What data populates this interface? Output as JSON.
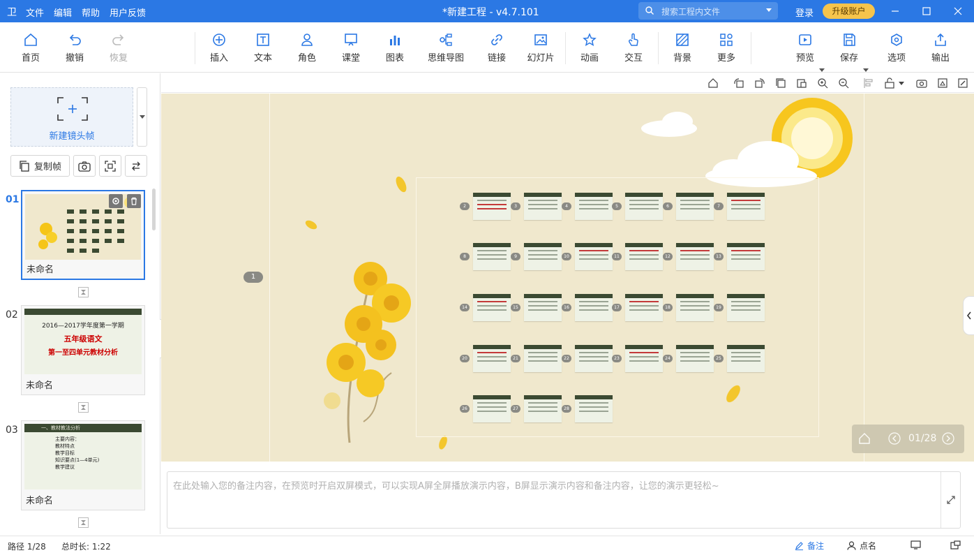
{
  "app": {
    "logo": "卫",
    "title": "*新建工程 - v4.7.101",
    "menu": [
      "文件",
      "编辑",
      "帮助",
      "用户反馈"
    ],
    "search_placeholder": "搜索工程内文件",
    "login": "登录",
    "upgrade": "升级账户"
  },
  "toolbar": {
    "home": "首页",
    "undo": "撤销",
    "redo": "恢复",
    "insert": "插入",
    "text": "文本",
    "role": "角色",
    "classroom": "课堂",
    "chart": "图表",
    "mindmap": "思维导图",
    "link": "链接",
    "slideshow": "幻灯片",
    "animation": "动画",
    "interaction": "交互",
    "background": "背景",
    "more": "更多",
    "preview": "预览",
    "save": "保存",
    "options": "选项",
    "export": "输出"
  },
  "sidebar": {
    "new_frame": "新建镜头帧",
    "copy_frame": "复制帧",
    "frames": [
      {
        "num": "01",
        "name": "未命名"
      },
      {
        "num": "02",
        "name": "未命名",
        "line1": "2016—2017学年度第一学期",
        "line2": "五年级语文",
        "line3": "第一至四单元教材分析"
      },
      {
        "num": "03",
        "name": "未命名",
        "header": "一、教材教法分析",
        "lines": [
          "主要内容：",
          "教材特点",
          "教学目标",
          "知识要点(1—4单元)",
          "教学建议"
        ]
      }
    ]
  },
  "canvas": {
    "path_marker": "1",
    "slide_badges": [
      "2",
      "3",
      "4",
      "5",
      "6",
      "7",
      "8",
      "9",
      "10",
      "11",
      "12",
      "13",
      "14",
      "15",
      "16",
      "17",
      "18",
      "19",
      "20",
      "21",
      "22",
      "23",
      "24",
      "25",
      "26",
      "27",
      "28"
    ],
    "nav_counter": "01/28"
  },
  "notes": {
    "placeholder": "在此处输入您的备注内容，在预览时开启双屏模式，可以实现A屏全屏播放演示内容，B屏显示演示内容和备注内容，让您的演示更轻松~"
  },
  "status": {
    "path": "路径 1/28",
    "duration": "总时长: 1:22",
    "notes": "备注",
    "rollcall": "点名"
  },
  "colors": {
    "brand": "#2b78e4",
    "upgrade": "#f6c44c",
    "canvas_bg": "#f0e8cd"
  }
}
